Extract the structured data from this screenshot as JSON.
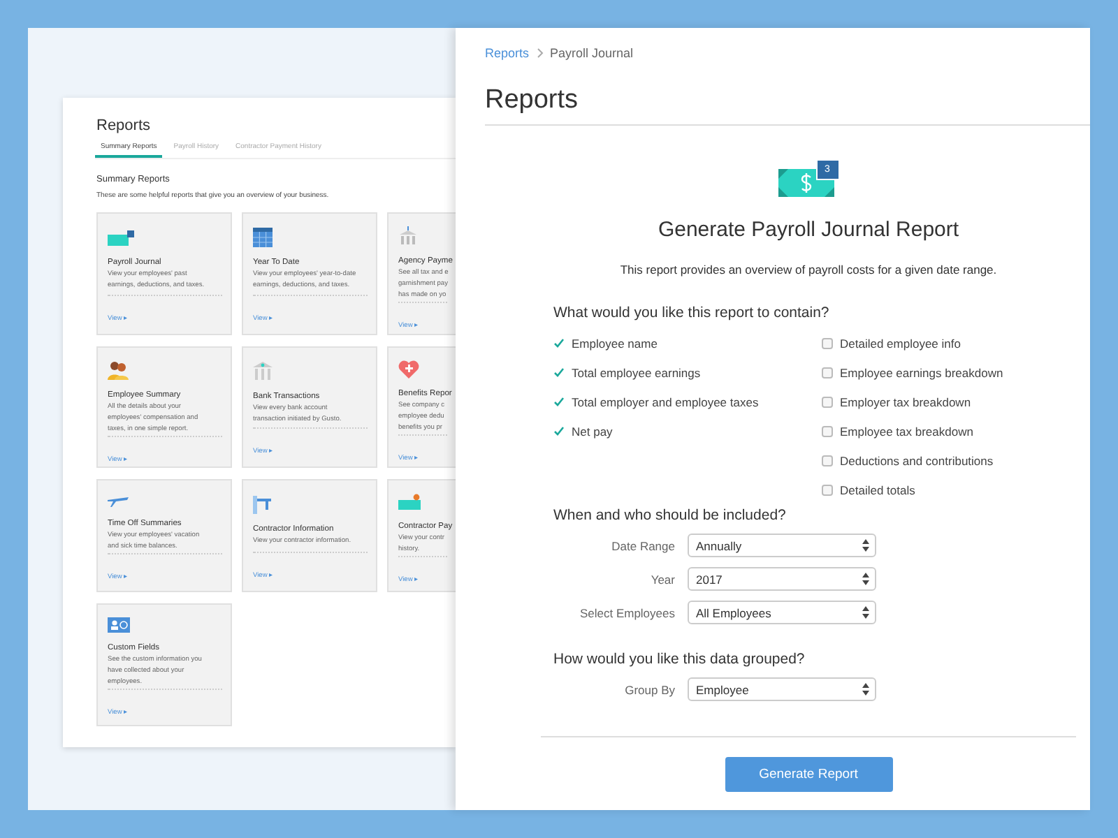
{
  "background_window": {
    "title": "Reports",
    "tabs": [
      {
        "label": "Summary Reports",
        "selected": true
      },
      {
        "label": "Payroll History",
        "selected": false
      },
      {
        "label": "Contractor Payment History",
        "selected": false
      }
    ],
    "section": {
      "title": "Summary Reports",
      "subtitle": "These are some helpful reports that give you an overview of your business."
    },
    "cards": [
      {
        "title": "Payroll Journal",
        "description_lines": [
          "View your employees' past",
          "earnings, deductions, and taxes."
        ],
        "link": "View ▸"
      },
      {
        "title": "Year To Date",
        "description_lines": [
          "View your employees' year-to-date",
          "earnings, deductions, and taxes."
        ],
        "link": "View ▸"
      },
      {
        "title": "Agency Payme",
        "description_lines": [
          "See all tax and e",
          "garnishment pay",
          "has made on yo"
        ],
        "link": "View ▸"
      },
      {
        "title": "Employee Summary",
        "description_lines": [
          "All the details about your",
          "employees' compensation and",
          "taxes, in one simple report."
        ],
        "link": "View ▸"
      },
      {
        "title": "Bank Transactions",
        "description_lines": [
          "View every bank account",
          "transaction initiated by Gusto."
        ],
        "link": "View ▸"
      },
      {
        "title": "Benefits Repor",
        "description_lines": [
          "See company c",
          "employee dedu",
          "benefits you pr"
        ],
        "link": "View ▸"
      },
      {
        "title": "Time Off Summaries",
        "description_lines": [
          "View your employees' vacation",
          "and sick time balances."
        ],
        "link": "View ▸"
      },
      {
        "title": "Contractor Information",
        "description_lines": [
          "View your contractor information."
        ],
        "link": "View ▸"
      },
      {
        "title": "Contractor Pay",
        "description_lines": [
          "View your contr",
          "history."
        ],
        "link": "View ▸"
      },
      {
        "title": "Custom Fields",
        "description_lines": [
          "See the custom information you",
          "have collected about your",
          "employees."
        ],
        "link": "View ▸"
      }
    ]
  },
  "window": {
    "breadcrumb": [
      {
        "label": "Reports",
        "link": true
      },
      {
        "label": "Payroll Journal",
        "link": false
      }
    ],
    "title": "Reports",
    "icon_badge": "3",
    "heading": "Generate Payroll Journal Report",
    "description": "This report provides an overview of payroll costs for a given date range.",
    "contents": {
      "question": "What would you like this report to contain?",
      "columns": [
        [
          {
            "label": "Employee name",
            "checked": true
          },
          {
            "label": "Total employee earnings",
            "checked": true
          },
          {
            "label": "Total employer and employee taxes",
            "checked": true
          },
          {
            "label": "Net pay",
            "checked": true
          }
        ],
        [
          {
            "label": "Detailed employee info",
            "checked": false
          },
          {
            "label": "Employee earnings breakdown",
            "checked": false
          },
          {
            "label": "Employer tax breakdown",
            "checked": false
          },
          {
            "label": "Employee tax breakdown",
            "checked": false
          },
          {
            "label": "Deductions and contributions",
            "checked": false
          },
          {
            "label": "Detailed totals",
            "checked": false
          }
        ]
      ]
    },
    "inclusion": {
      "question": "When and who should be included?",
      "fields": [
        {
          "label": "Date Range",
          "value": "Annually"
        },
        {
          "label": "Year",
          "value": "2017"
        },
        {
          "label": "Select Employees",
          "value": "All Employees"
        }
      ]
    },
    "grouping": {
      "question": "How would you like this data grouped?",
      "fields": [
        {
          "label": "Group By",
          "value": "Employee"
        }
      ]
    },
    "button": "Generate Report"
  }
}
